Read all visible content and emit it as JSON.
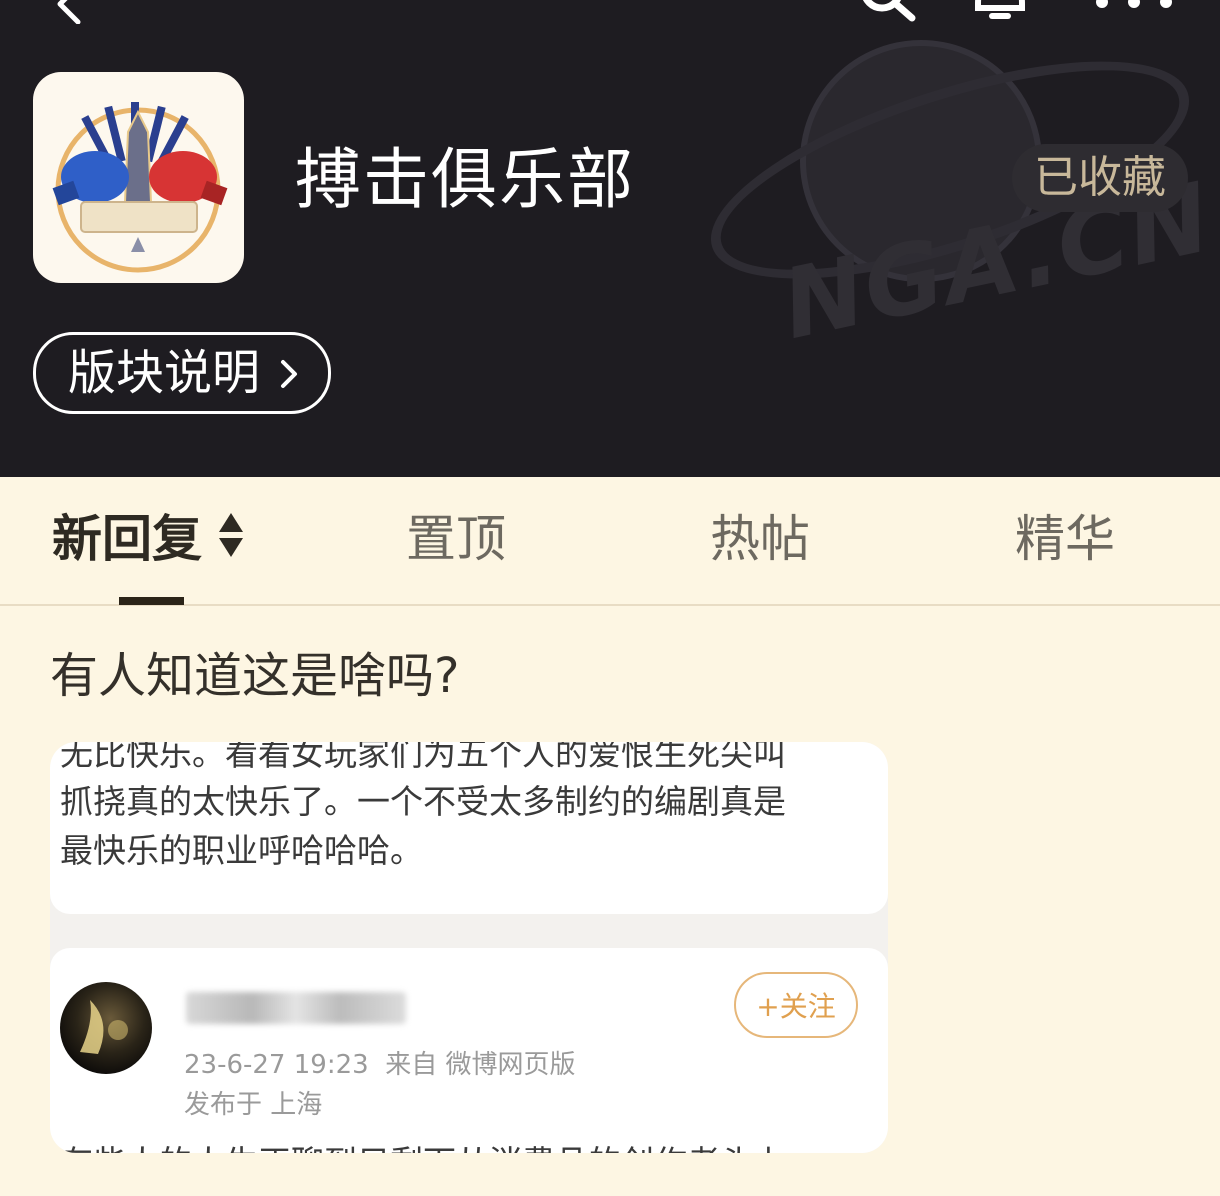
{
  "forum": {
    "title": "搏击俱乐部",
    "favorite_label": "已收藏",
    "intro_label": "版块说明",
    "watermark": "NGA.CN"
  },
  "tabs": [
    {
      "label": "新回复",
      "active": true
    },
    {
      "label": "置顶",
      "active": false
    },
    {
      "label": "热帖",
      "active": false
    },
    {
      "label": "精华",
      "active": false
    }
  ],
  "post": {
    "title": "有人知道这是啥吗?",
    "image": {
      "lines": [
        "无比快乐。看看女玩家们为五个人的爱恨生死尖叫",
        "抓挠真的太快乐了。一个不受太多制约的编剧真是",
        "最快乐的职业呼哈哈哈。"
      ],
      "follow_label": "+关注",
      "timestamp": "23-6-27 19:23",
      "source": "来自 微博网页版",
      "location": "发布于 上海",
      "cut_line": "有些人的人生正聊到只剩下从消费品的创作者头上"
    }
  },
  "colors": {
    "header_bg": "#1e1c21",
    "page_bg": "#fdf6e3",
    "favorite_text": "#c8b89a",
    "follow_accent": "#e0a04f"
  },
  "icons": [
    "back-arrow-icon",
    "search-icon",
    "bell-icon",
    "more-icon",
    "chevron-right-icon",
    "sort-icon"
  ]
}
